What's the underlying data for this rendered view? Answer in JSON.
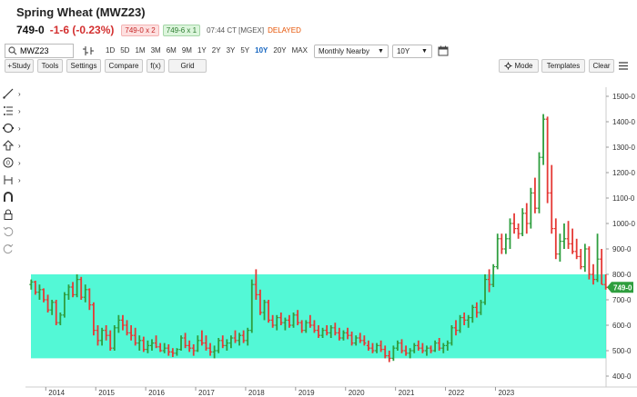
{
  "header": {
    "title": "Spring Wheat (MWZ23)",
    "last": "749-0",
    "change": "-1-6 (-0.23%)",
    "bid": "749-0 x 2",
    "ask": "749-6 x 1",
    "time": "07:44 CT [MGEX]",
    "status": "DELAYED"
  },
  "toolbar": {
    "symbol": "MWZ23",
    "periods": [
      "1D",
      "5D",
      "1M",
      "3M",
      "6M",
      "9M",
      "1Y",
      "2Y",
      "3Y",
      "5Y",
      "10Y",
      "20Y",
      "MAX"
    ],
    "active_period": "10Y",
    "aggregation": "Monthly Nearby",
    "range": "10Y",
    "study": "+Study",
    "tools": "Tools",
    "settings": "Settings",
    "compare": "Compare",
    "fx": "f(x)",
    "grid": "Grid",
    "mode": "Mode",
    "templates": "Templates",
    "clear": "Clear"
  },
  "left_tools": [
    "line-draw-icon",
    "fib-icon",
    "shape-icon",
    "arrow-icon",
    "text-icon",
    "measure-icon",
    "magnet-icon",
    "lock-icon",
    "undo-icon",
    "redo-icon"
  ],
  "chart_data": {
    "type": "ohlc",
    "y_axis_labels": [
      "1500-0",
      "1400-0",
      "1300-0",
      "1200-0",
      "1100-0",
      "1000-0",
      "900-0",
      "800-0",
      "700-0",
      "600-0",
      "500-0",
      "400-0"
    ],
    "x_axis_labels": [
      "2014",
      "2015",
      "2016",
      "2017",
      "2018",
      "2019",
      "2020",
      "2021",
      "2022",
      "2023"
    ],
    "ylim": [
      400,
      1500
    ],
    "last_price_label": "749-0",
    "highlight_band": {
      "low": 470,
      "high": 800,
      "color": "#19f5c8"
    },
    "up_color": "#2e9e3e",
    "down_color": "#e53935",
    "start": [
      2013,
      9
    ],
    "close_ohlc": [
      [
        760,
        780,
        740,
        770
      ],
      [
        770,
        775,
        720,
        730
      ],
      [
        730,
        760,
        700,
        740
      ],
      [
        740,
        745,
        690,
        700
      ],
      [
        700,
        720,
        650,
        660
      ],
      [
        660,
        700,
        640,
        690
      ],
      [
        690,
        700,
        600,
        610
      ],
      [
        610,
        650,
        600,
        640
      ],
      [
        640,
        730,
        630,
        720
      ],
      [
        720,
        760,
        700,
        750
      ],
      [
        750,
        770,
        710,
        720
      ],
      [
        720,
        800,
        710,
        780
      ],
      [
        780,
        790,
        700,
        710
      ],
      [
        710,
        760,
        690,
        740
      ],
      [
        740,
        745,
        660,
        680
      ],
      [
        680,
        690,
        560,
        580
      ],
      [
        580,
        600,
        520,
        540
      ],
      [
        540,
        590,
        520,
        580
      ],
      [
        580,
        600,
        540,
        560
      ],
      [
        560,
        580,
        500,
        510
      ],
      [
        510,
        600,
        500,
        590
      ],
      [
        590,
        640,
        570,
        620
      ],
      [
        620,
        640,
        580,
        600
      ],
      [
        600,
        620,
        560,
        570
      ],
      [
        570,
        600,
        540,
        560
      ],
      [
        560,
        590,
        520,
        530
      ],
      [
        530,
        560,
        500,
        540
      ],
      [
        540,
        555,
        495,
        505
      ],
      [
        505,
        540,
        490,
        520
      ],
      [
        520,
        545,
        500,
        530
      ],
      [
        530,
        560,
        510,
        515
      ],
      [
        515,
        530,
        495,
        500
      ],
      [
        500,
        530,
        490,
        510
      ],
      [
        510,
        525,
        480,
        495
      ],
      [
        495,
        510,
        475,
        490
      ],
      [
        490,
        510,
        480,
        505
      ],
      [
        505,
        560,
        500,
        550
      ],
      [
        550,
        570,
        510,
        520
      ],
      [
        520,
        540,
        495,
        510
      ],
      [
        510,
        525,
        480,
        500
      ],
      [
        500,
        560,
        495,
        540
      ],
      [
        540,
        580,
        520,
        530
      ],
      [
        530,
        560,
        500,
        510
      ],
      [
        510,
        530,
        480,
        495
      ],
      [
        495,
        520,
        470,
        500
      ],
      [
        500,
        550,
        490,
        540
      ],
      [
        540,
        560,
        510,
        520
      ],
      [
        520,
        545,
        500,
        530
      ],
      [
        530,
        560,
        510,
        550
      ],
      [
        550,
        580,
        530,
        540
      ],
      [
        540,
        570,
        520,
        560
      ],
      [
        560,
        580,
        530,
        540
      ],
      [
        540,
        590,
        520,
        580
      ],
      [
        580,
        780,
        570,
        760
      ],
      [
        760,
        820,
        700,
        720
      ],
      [
        720,
        740,
        640,
        650
      ],
      [
        650,
        700,
        620,
        690
      ],
      [
        690,
        700,
        610,
        620
      ],
      [
        620,
        640,
        590,
        600
      ],
      [
        600,
        640,
        580,
        630
      ],
      [
        630,
        650,
        600,
        610
      ],
      [
        610,
        630,
        580,
        620
      ],
      [
        620,
        640,
        590,
        600
      ],
      [
        600,
        650,
        590,
        640
      ],
      [
        640,
        660,
        600,
        610
      ],
      [
        610,
        620,
        570,
        580
      ],
      [
        580,
        620,
        570,
        610
      ],
      [
        610,
        640,
        590,
        600
      ],
      [
        600,
        620,
        570,
        580
      ],
      [
        580,
        600,
        550,
        560
      ],
      [
        560,
        590,
        550,
        580
      ],
      [
        580,
        600,
        560,
        570
      ],
      [
        570,
        600,
        550,
        590
      ],
      [
        590,
        610,
        560,
        570
      ],
      [
        570,
        590,
        540,
        550
      ],
      [
        550,
        580,
        540,
        570
      ],
      [
        570,
        590,
        545,
        560
      ],
      [
        560,
        575,
        520,
        530
      ],
      [
        530,
        560,
        520,
        550
      ],
      [
        550,
        570,
        530,
        540
      ],
      [
        540,
        560,
        520,
        530
      ],
      [
        520,
        540,
        500,
        510
      ],
      [
        510,
        530,
        490,
        500
      ],
      [
        500,
        530,
        490,
        520
      ],
      [
        520,
        540,
        495,
        505
      ],
      [
        505,
        520,
        470,
        480
      ],
      [
        480,
        500,
        455,
        470
      ],
      [
        470,
        520,
        460,
        510
      ],
      [
        510,
        540,
        500,
        530
      ],
      [
        530,
        545,
        490,
        500
      ],
      [
        500,
        520,
        480,
        490
      ],
      [
        490,
        510,
        470,
        500
      ],
      [
        500,
        530,
        490,
        520
      ],
      [
        520,
        540,
        500,
        510
      ],
      [
        510,
        530,
        490,
        500
      ],
      [
        500,
        520,
        480,
        510
      ],
      [
        510,
        520,
        490,
        500
      ],
      [
        500,
        540,
        495,
        530
      ],
      [
        530,
        550,
        500,
        510
      ],
      [
        510,
        530,
        490,
        520
      ],
      [
        520,
        540,
        500,
        530
      ],
      [
        530,
        600,
        520,
        590
      ],
      [
        590,
        620,
        560,
        580
      ],
      [
        580,
        640,
        570,
        630
      ],
      [
        630,
        650,
        600,
        620
      ],
      [
        620,
        640,
        590,
        630
      ],
      [
        630,
        680,
        610,
        670
      ],
      [
        670,
        690,
        630,
        650
      ],
      [
        650,
        700,
        640,
        690
      ],
      [
        690,
        800,
        680,
        780
      ],
      [
        780,
        820,
        730,
        760
      ],
      [
        760,
        840,
        750,
        830
      ],
      [
        830,
        960,
        820,
        940
      ],
      [
        940,
        960,
        880,
        900
      ],
      [
        900,
        960,
        880,
        940
      ],
      [
        940,
        1020,
        900,
        1000
      ],
      [
        1000,
        1040,
        960,
        980
      ],
      [
        980,
        1000,
        940,
        960
      ],
      [
        960,
        1060,
        950,
        1040
      ],
      [
        1040,
        1080,
        960,
        1000
      ],
      [
        1000,
        1140,
        980,
        1120
      ],
      [
        1120,
        1180,
        1040,
        1060
      ],
      [
        1060,
        1280,
        1040,
        1260
      ],
      [
        1260,
        1430,
        1230,
        1410
      ],
      [
        1410,
        1420,
        1080,
        1120
      ],
      [
        1120,
        1230,
        960,
        980
      ],
      [
        980,
        1020,
        860,
        880
      ],
      [
        880,
        960,
        850,
        930
      ],
      [
        930,
        1000,
        900,
        940
      ],
      [
        940,
        1010,
        900,
        920
      ],
      [
        920,
        980,
        880,
        890
      ],
      [
        890,
        940,
        860,
        870
      ],
      [
        870,
        900,
        820,
        830
      ],
      [
        830,
        920,
        810,
        900
      ],
      [
        900,
        910,
        780,
        800
      ],
      [
        800,
        840,
        760,
        780
      ],
      [
        780,
        960,
        770,
        860
      ],
      [
        860,
        900,
        760,
        760
      ],
      [
        760,
        800,
        740,
        749
      ]
    ]
  }
}
